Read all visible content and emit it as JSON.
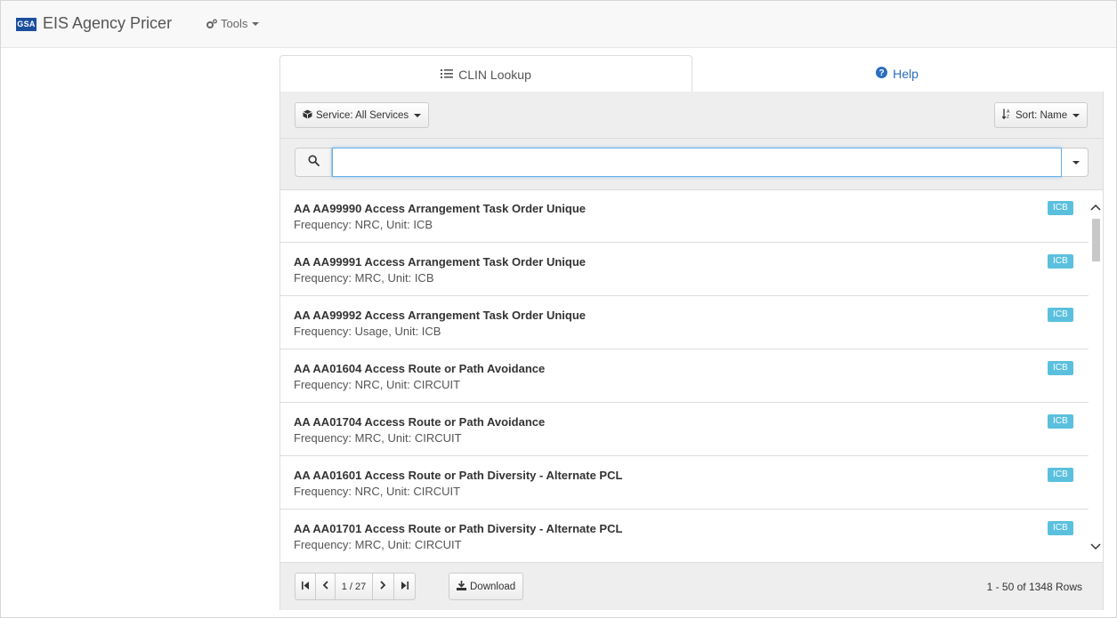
{
  "app": {
    "logo_text": "GSA",
    "title": "EIS Agency Pricer"
  },
  "nav": {
    "tools_label": "Tools"
  },
  "tabs": [
    {
      "label": "CLIN Lookup",
      "icon": "list-icon",
      "active": true
    },
    {
      "label": "Help",
      "icon": "question-circle-icon",
      "active": false
    }
  ],
  "toolbar": {
    "service_label": "Service: All Services",
    "sort_label": "Sort: Name"
  },
  "search": {
    "value": "",
    "placeholder": ""
  },
  "colors": {
    "accent": "#2a6ebd",
    "badge": "#5bc0de",
    "focus": "#66afe9",
    "logo": "#1b4f9c"
  },
  "results": [
    {
      "title": "AA AA99990 Access Arrangement Task Order Unique",
      "subtitle": "Frequency: NRC, Unit: ICB",
      "badge": "ICB"
    },
    {
      "title": "AA AA99991 Access Arrangement Task Order Unique",
      "subtitle": "Frequency: MRC, Unit: ICB",
      "badge": "ICB"
    },
    {
      "title": "AA AA99992 Access Arrangement Task Order Unique",
      "subtitle": "Frequency: Usage, Unit: ICB",
      "badge": "ICB"
    },
    {
      "title": "AA AA01604 Access Route or Path Avoidance",
      "subtitle": "Frequency: NRC, Unit: CIRCUIT",
      "badge": "ICB"
    },
    {
      "title": "AA AA01704 Access Route or Path Avoidance",
      "subtitle": "Frequency: MRC, Unit: CIRCUIT",
      "badge": "ICB"
    },
    {
      "title": "AA AA01601 Access Route or Path Diversity - Alternate PCL",
      "subtitle": "Frequency: NRC, Unit: CIRCUIT",
      "badge": "ICB"
    },
    {
      "title": "AA AA01701 Access Route or Path Diversity - Alternate PCL",
      "subtitle": "Frequency: MRC, Unit: CIRCUIT",
      "badge": "ICB"
    }
  ],
  "pagination": {
    "page_display": "1 / 27",
    "download_label": "Download",
    "rows_info": "1 - 50 of 1348 Rows"
  }
}
